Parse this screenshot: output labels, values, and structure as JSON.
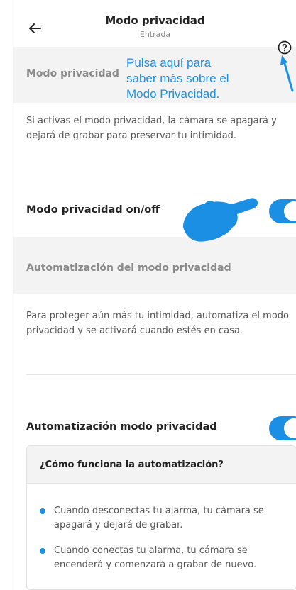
{
  "header": {
    "title": "Modo privacidad",
    "subtitle": "Entrada"
  },
  "section1": {
    "label": "Modo privacidad"
  },
  "annotation": {
    "lines": [
      "Pulsa aquí para",
      "saber más sobre el",
      "Modo Privacidad."
    ],
    "color": "#1a8fe3"
  },
  "description1": "Si activas el modo privacidad, la cámara se apagará y dejará de grabar para preservar tu intimidad.",
  "privacy_toggle": {
    "label": "Modo privacidad on/off",
    "state": "on"
  },
  "section2": {
    "label": "Automatización del modo privacidad"
  },
  "description2": "Para proteger aún más tu intimidad, automatiza el modo privacidad y se activará cuando estés en casa.",
  "automation_toggle": {
    "label": "Automatización modo privacidad",
    "state": "on"
  },
  "info_card": {
    "title": "¿Cómo funciona la automatización?",
    "bullets": [
      "Cuando desconectas tu alarma, tu cámara se apagará y dejará de grabar.",
      "Cuando conectas tu alarma, tu cámara se encenderá y comenzará a grabar de nuevo."
    ]
  },
  "colors": {
    "accent": "#1a8fe3",
    "section_bg": "#f3f3f3"
  },
  "icons": {
    "back": "arrow-left-icon",
    "help": "question-circle-icon",
    "pointer": "pointing-hand-icon"
  }
}
